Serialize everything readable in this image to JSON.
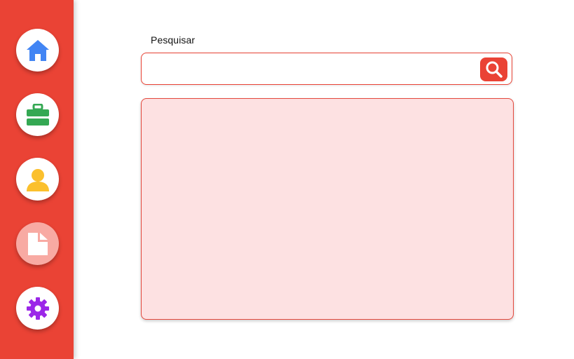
{
  "colors": {
    "sidebar": "#ea4335",
    "accent": "#ea4335",
    "panel_background": "#fde1e2",
    "active_nav": "#f8aaa3",
    "home_icon": "#4285f4",
    "work_icon": "#34a853",
    "user_icon": "#fbc02d",
    "document_icon": "#ffffff",
    "settings_icon": "#9b27e8"
  },
  "sidebar": {
    "items": [
      {
        "icon": "home-icon",
        "active": false
      },
      {
        "icon": "briefcase-icon",
        "active": false
      },
      {
        "icon": "user-icon",
        "active": false
      },
      {
        "icon": "document-icon",
        "active": true
      },
      {
        "icon": "gear-icon",
        "active": false
      }
    ]
  },
  "search": {
    "label": "Pesquisar",
    "value": "",
    "placeholder": "",
    "button_icon": "search-icon"
  },
  "results": {
    "items": []
  }
}
